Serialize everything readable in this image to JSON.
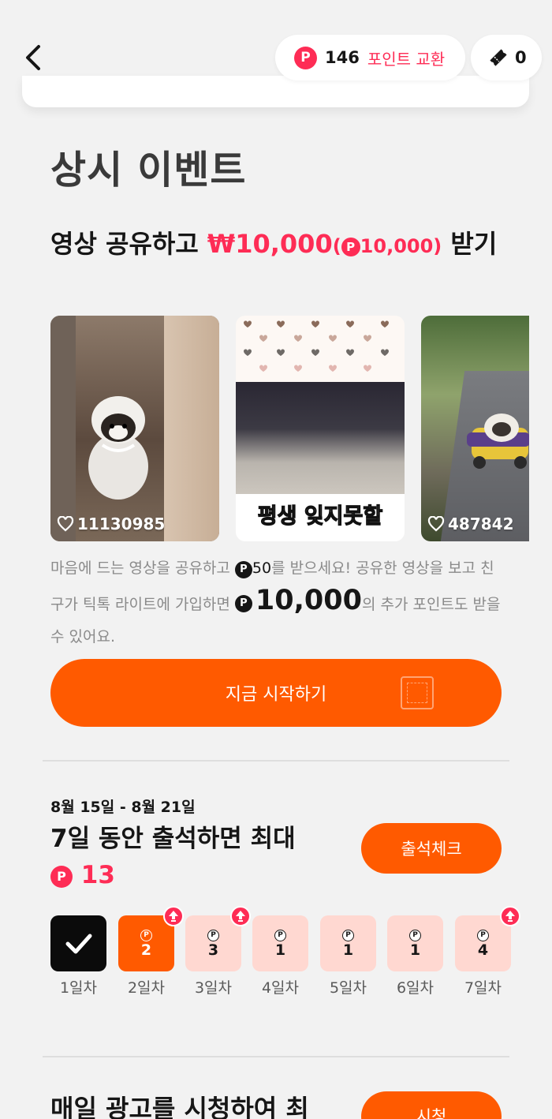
{
  "header": {
    "points_value": "146",
    "points_link": "포인트 교환",
    "ticket_count": "0",
    "point_glyph": "P"
  },
  "section": {
    "title": "상시 이벤트"
  },
  "share": {
    "title_pre": "영상 공유하고 ",
    "title_amount": "₩10,000",
    "title_points_open": "(",
    "title_points_value": "10,000",
    "title_points_close": ")",
    "title_post": " 받기",
    "videos": [
      {
        "likes": "11130985"
      },
      {
        "caption": "평생 잊지못할"
      },
      {
        "likes": "487842"
      }
    ],
    "desc_part1": "마음에 드는 영상을 공유하고 ",
    "desc_reward": "50",
    "desc_part2": "를 받으세요! 공유한 영상을 보고 친구가 틱톡 라이트에 가입하면 ",
    "desc_big": "10,000",
    "desc_part3": "의 추가 포인트도 받을 수 있어요.",
    "button_label": "지금 시작하기"
  },
  "attendance": {
    "date_range": "8월 15일 - 8월 21일",
    "title": "7일 동안 출석하면 최대",
    "max_points": "13",
    "button_label": "출석체크",
    "days": [
      {
        "label": "1일차",
        "amount": "",
        "state": "done",
        "boost": false
      },
      {
        "label": "2일차",
        "amount": "2",
        "state": "today",
        "boost": true
      },
      {
        "label": "3일차",
        "amount": "3",
        "state": "upcoming",
        "boost": true
      },
      {
        "label": "4일차",
        "amount": "1",
        "state": "upcoming",
        "boost": false
      },
      {
        "label": "5일차",
        "amount": "1",
        "state": "upcoming",
        "boost": false
      },
      {
        "label": "6일차",
        "amount": "1",
        "state": "upcoming",
        "boost": false
      },
      {
        "label": "7일차",
        "amount": "4",
        "state": "upcoming",
        "boost": true
      }
    ]
  },
  "ads": {
    "title": "매일 광고를 시청하여 최",
    "button_label": "시청"
  },
  "colors": {
    "accent_orange": "#ff5a00",
    "accent_red": "#fe2c55",
    "day_upcoming_bg": "#ffd8d1",
    "background": "#f2f2f2"
  },
  "icons": [
    "back-arrow-icon",
    "point-coin-icon",
    "ticket-icon",
    "heart-icon",
    "check-icon",
    "boost-arrow-icon",
    "stamp-icon"
  ]
}
